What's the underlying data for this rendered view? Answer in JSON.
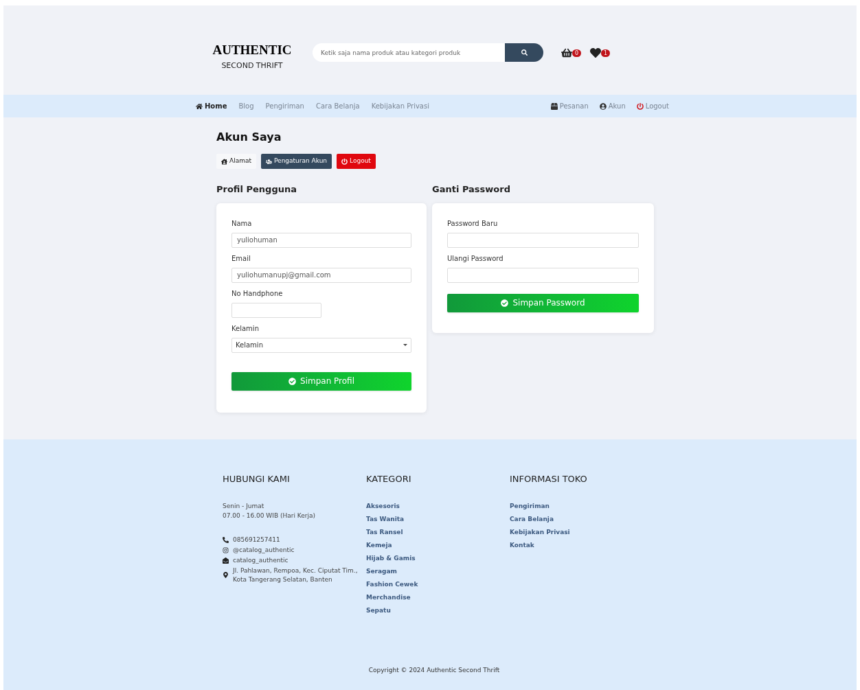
{
  "logo": {
    "title": "AUTHENTIC",
    "subtitle": "SECOND THRIFT"
  },
  "search": {
    "placeholder": "Ketik saja nama produk atau kategori produk"
  },
  "header_icons": [
    {
      "kind": "basket",
      "count": "0"
    },
    {
      "kind": "heart",
      "count": "1"
    }
  ],
  "nav": {
    "left": [
      {
        "label": "Home",
        "kind": "home",
        "selected": true
      },
      {
        "label": "Blog",
        "kind": "link",
        "selected": false
      },
      {
        "label": "Pengiriman",
        "kind": "link",
        "selected": false
      },
      {
        "label": "Cara Belanja",
        "kind": "link",
        "selected": false
      },
      {
        "label": "Kebijakan Privasi",
        "kind": "link",
        "selected": false
      }
    ],
    "right": [
      {
        "label": "Pesanan",
        "kind": "orders"
      },
      {
        "label": "Akun",
        "kind": "account"
      },
      {
        "label": "Logout",
        "kind": "logout"
      }
    ]
  },
  "page_title": "Akun Saya",
  "account_tabs": [
    {
      "label": "Alamat",
      "kind": "address",
      "selected": false
    },
    {
      "label": "Pengaturan Akun",
      "kind": "settings",
      "selected": true
    },
    {
      "label": "Logout",
      "kind": "logout"
    }
  ],
  "profile": {
    "title": "Profil Pengguna",
    "fields": [
      {
        "label": "Nama",
        "value": "yuliohuman",
        "kind": "wide"
      },
      {
        "label": "Email",
        "value": "yuliohumanupj@gmail.com",
        "kind": "wide"
      },
      {
        "label": "No Handphone",
        "kind": "short"
      },
      {
        "label": "Kelamin",
        "value": "Kelamin",
        "kind": "select"
      }
    ],
    "button": "Simpan Profil"
  },
  "password": {
    "title": "Ganti Password",
    "fields": [
      {
        "label": "Password Baru",
        "kind": "wide"
      },
      {
        "label": "Ulangi Password",
        "kind": "wide"
      }
    ],
    "button": "Simpan Password"
  },
  "footer": {
    "contact": {
      "title": "HUBUNGI KAMI",
      "hours": [
        "Senin - Jumat",
        "07.00 - 16.00 WIB (Hari Kerja)"
      ],
      "items": [
        {
          "kind": "phone",
          "text": "085691257411"
        },
        {
          "kind": "instagram",
          "text": "@catalog_authentic"
        },
        {
          "kind": "mail",
          "text": "catalog_authentic"
        },
        {
          "kind": "location",
          "text": "Jl. Pahlawan, Rempoa, Kec. Ciputat Tim., Kota Tangerang Selatan, Banten"
        }
      ]
    },
    "categories": {
      "title": "KATEGORI",
      "links": [
        "Aksesoris",
        "Tas Wanita",
        "Tas Ransel",
        "Kemeja",
        "Hijab & Gamis",
        "Seragam",
        "Fashion Cewek",
        "Merchandise",
        "Sepatu"
      ]
    },
    "info": {
      "title": "INFORMASI TOKO",
      "links": [
        "Pengiriman",
        "Cara Belanja",
        "Kebijakan Privasi",
        "Kontak"
      ]
    },
    "copyright": "Copyright © 2024 Authentic Second Thrift"
  }
}
